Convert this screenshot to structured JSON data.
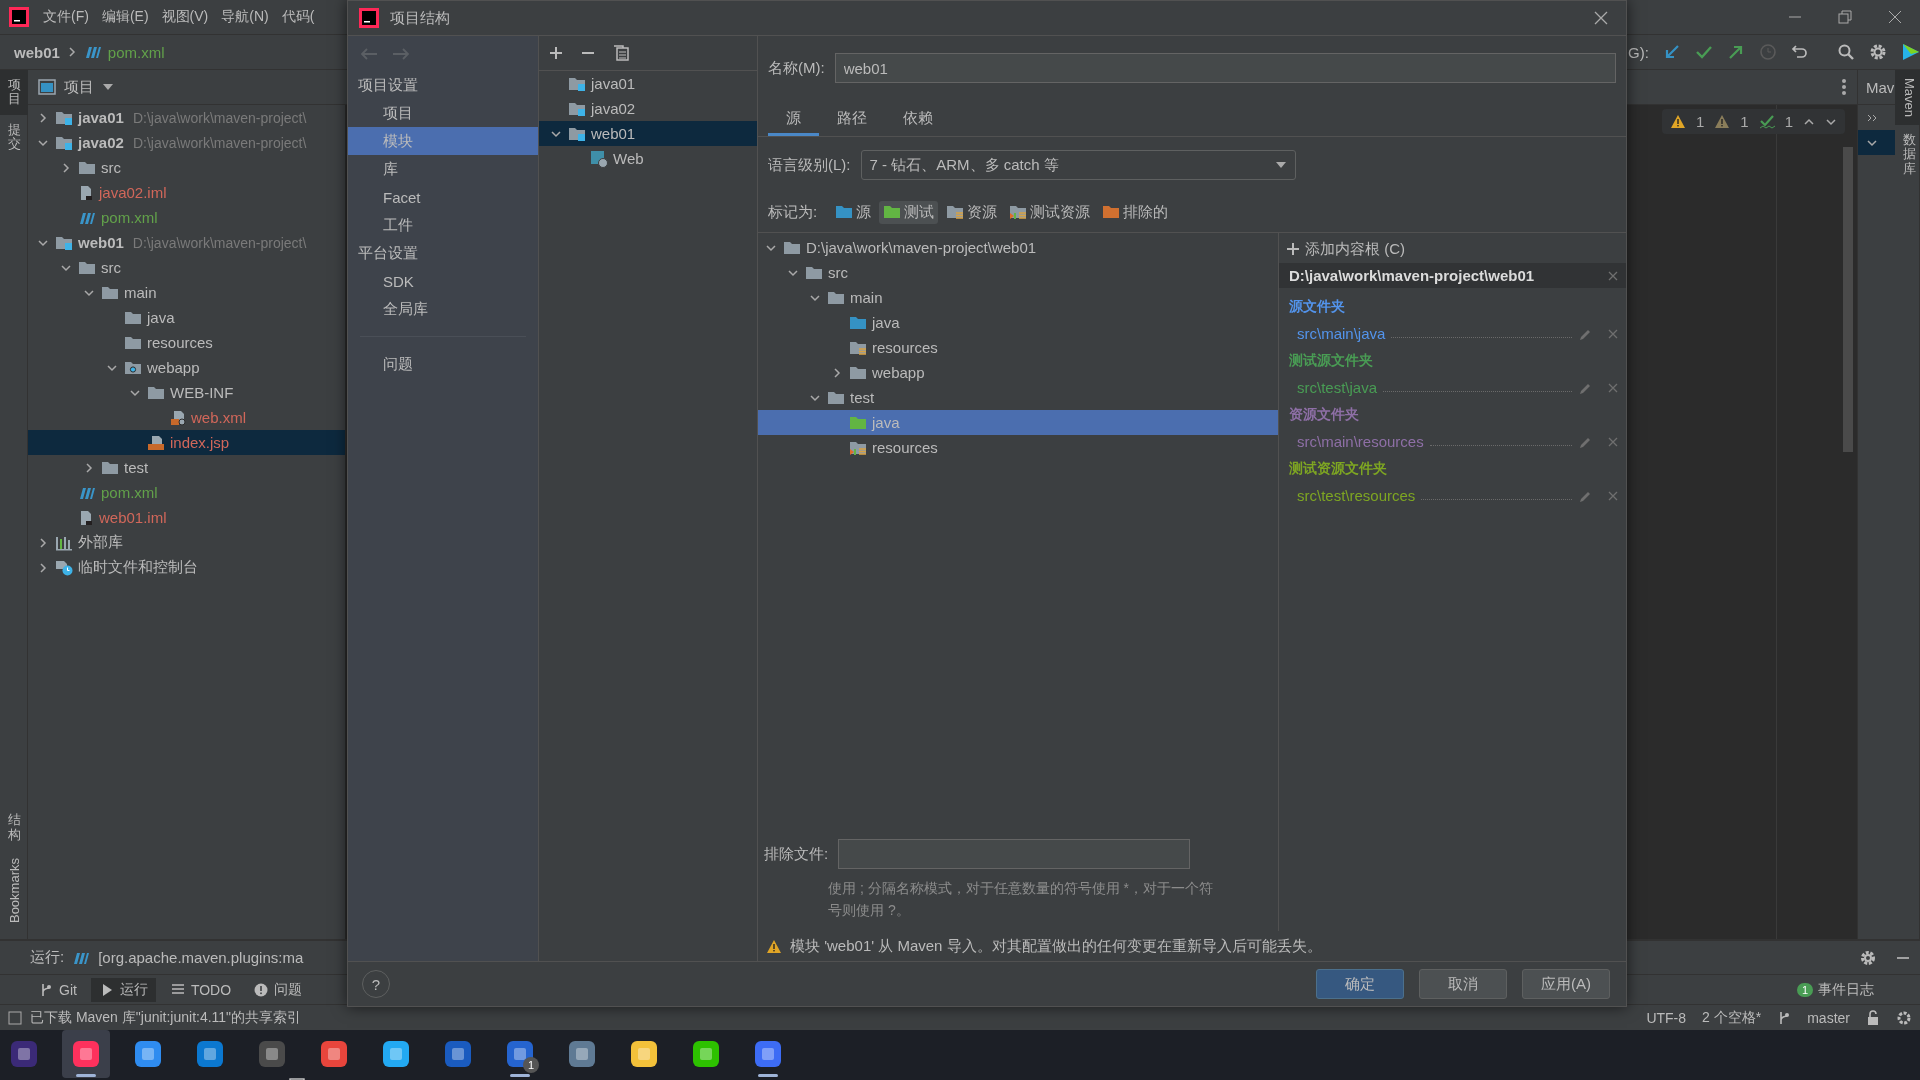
{
  "menu_bar": {
    "items": [
      "文件(F)",
      "编辑(E)",
      "视图(V)",
      "导航(N)",
      "代码("
    ]
  },
  "nav_bar": {
    "breadcrumbs": [
      {
        "label": "web01",
        "kind": "module"
      },
      {
        "label": "pom.xml",
        "kind": "maven"
      }
    ],
    "vcs_label": "G):"
  },
  "left_tool_strip": {
    "top": [
      {
        "label": "项目",
        "stacked": true,
        "selected": true
      },
      {
        "label": "提交",
        "stacked": true,
        "selected": false
      }
    ],
    "bottom": [
      {
        "label": "结构",
        "stacked": true,
        "selected": false
      },
      {
        "label": "Bookmarks",
        "stacked": false,
        "selected": false
      }
    ]
  },
  "project_panel": {
    "title": "项目",
    "tree": [
      {
        "name": "java01",
        "kind": "module",
        "path": "D:\\java\\work\\maven-project\\",
        "expanded": false,
        "selected": false
      },
      {
        "name": "java02",
        "kind": "module",
        "path": "D:\\java\\work\\maven-project\\",
        "expanded": true,
        "selected": false,
        "children": [
          {
            "name": "src",
            "kind": "folder",
            "expanded": false,
            "selected": false
          },
          {
            "name": "java02.iml",
            "kind": "iml",
            "color": "#d1675a",
            "selected": false
          },
          {
            "name": "pom.xml",
            "kind": "maven",
            "color": "#62a14a",
            "selected": false
          }
        ]
      },
      {
        "name": "web01",
        "kind": "module",
        "path": "D:\\java\\work\\maven-project\\",
        "expanded": true,
        "selected": false,
        "children": [
          {
            "name": "src",
            "kind": "folder",
            "expanded": true,
            "selected": false,
            "children": [
              {
                "name": "main",
                "kind": "folder",
                "expanded": true,
                "selected": false,
                "children": [
                  {
                    "name": "java",
                    "kind": "folder",
                    "selected": false
                  },
                  {
                    "name": "resources",
                    "kind": "folder",
                    "selected": false
                  },
                  {
                    "name": "webapp",
                    "kind": "web_folder",
                    "expanded": true,
                    "selected": false,
                    "children": [
                      {
                        "name": "WEB-INF",
                        "kind": "folder",
                        "expanded": true,
                        "selected": false,
                        "children": [
                          {
                            "name": "web.xml",
                            "kind": "web_xml",
                            "color": "#d1675a",
                            "selected": false
                          }
                        ]
                      },
                      {
                        "name": "index.jsp",
                        "kind": "jsp",
                        "color": "#d1675a",
                        "selected": true
                      }
                    ]
                  }
                ]
              },
              {
                "name": "test",
                "kind": "folder",
                "expanded": false,
                "selected": false
              }
            ]
          },
          {
            "name": "pom.xml",
            "kind": "maven",
            "color": "#62a14a",
            "selected": false
          },
          {
            "name": "web01.iml",
            "kind": "iml",
            "color": "#d1675a",
            "selected": false
          }
        ]
      },
      {
        "name": "外部库",
        "kind": "libraries",
        "expanded": false,
        "selected": false
      },
      {
        "name": "临时文件和控制台",
        "kind": "scratches",
        "expanded": false,
        "selected": false
      }
    ]
  },
  "editor": {
    "problems": [
      {
        "kind": "warning",
        "count": "1"
      },
      {
        "kind": "weak_warning",
        "count": "1"
      },
      {
        "kind": "typo",
        "count": "1"
      }
    ]
  },
  "maven_panel": {
    "title": "Mav"
  },
  "right_tool_strip": [
    {
      "label": "Maven",
      "stacked": false,
      "selected": true
    },
    {
      "label": "数据库",
      "stacked": true,
      "selected": false
    }
  ],
  "run_bar": {
    "label": "运行:",
    "config": "[org.apache.maven.plugins:ma"
  },
  "tool_tabs": [
    {
      "label": "Git",
      "kind": "git",
      "selected": false
    },
    {
      "label": "运行",
      "kind": "run",
      "selected": true
    },
    {
      "label": "TODO",
      "kind": "todo",
      "selected": false
    },
    {
      "label": "问题",
      "kind": "problems",
      "selected": false
    }
  ],
  "event_log": {
    "label": "事件日志",
    "badge": "1"
  },
  "status_bar": {
    "message": "已下载 Maven 库\"junit:junit:4.11\"的共享索引",
    "encoding": "UTF-8",
    "indent": "2 个空格*",
    "branch": "master"
  },
  "dialog": {
    "title": "项目结构",
    "nav": {
      "groups": [
        {
          "heading": "项目设置",
          "items": [
            {
              "label": "项目",
              "selected": false
            },
            {
              "label": "模块",
              "selected": true
            },
            {
              "label": "库",
              "selected": false
            },
            {
              "label": "Facet",
              "selected": false
            },
            {
              "label": "工件",
              "selected": false
            }
          ]
        },
        {
          "heading": "平台设置",
          "items": [
            {
              "label": "SDK",
              "selected": false
            },
            {
              "label": "全局库",
              "selected": false
            }
          ]
        }
      ],
      "problems": {
        "label": "问题",
        "selected": false
      }
    },
    "modules": [
      {
        "name": "java01",
        "kind": "module",
        "selected": false
      },
      {
        "name": "java02",
        "kind": "module",
        "selected": false
      },
      {
        "name": "web01",
        "kind": "module",
        "expanded": true,
        "selected": true,
        "children": [
          {
            "name": "Web",
            "kind": "web_facet",
            "selected": false
          }
        ]
      }
    ],
    "name_field": {
      "label": "名称(M):",
      "value": "web01"
    },
    "tabs": [
      {
        "label": "源",
        "selected": true
      },
      {
        "label": "路径",
        "selected": false
      },
      {
        "label": "依赖",
        "selected": false
      }
    ],
    "language_level": {
      "label": "语言级别(L):",
      "value": "7 - 钻石、ARM、多 catch 等"
    },
    "mark_as": {
      "label": "标记为:",
      "options": [
        {
          "label": "源",
          "kind": "sources",
          "selected": false
        },
        {
          "label": "测试",
          "kind": "tests",
          "selected": true
        },
        {
          "label": "资源",
          "kind": "resources",
          "selected": false
        },
        {
          "label": "测试资源",
          "kind": "test_resources",
          "selected": false
        },
        {
          "label": "排除的",
          "kind": "excluded",
          "selected": false
        }
      ]
    },
    "content_tree": [
      {
        "name": "D:\\java\\work\\maven-project\\web01",
        "kind": "folder",
        "expanded": true,
        "selected": false,
        "children": [
          {
            "name": "src",
            "kind": "folder",
            "expanded": true,
            "selected": false,
            "children": [
              {
                "name": "main",
                "kind": "folder",
                "expanded": true,
                "selected": false,
                "children": [
                  {
                    "name": "java",
                    "kind": "sources",
                    "selected": false
                  },
                  {
                    "name": "resources",
                    "kind": "resources",
                    "selected": false
                  },
                  {
                    "name": "webapp",
                    "kind": "folder",
                    "expanded": false,
                    "selected": false
                  }
                ]
              },
              {
                "name": "test",
                "kind": "folder",
                "expanded": true,
                "selected": false,
                "children": [
                  {
                    "name": "java",
                    "kind": "tests",
                    "selected": true
                  },
                  {
                    "name": "resources",
                    "kind": "test_resources",
                    "selected": false
                  }
                ]
              }
            ]
          }
        ]
      }
    ],
    "add_content_root": "添加内容根 (C)",
    "content_root": {
      "path": "D:\\java\\work\\maven-project\\web01",
      "folders": [
        {
          "heading": "源文件夹",
          "path": "src\\main\\java",
          "color": "#5394ec"
        },
        {
          "heading": "测试源文件夹",
          "path": "src\\test\\java",
          "color": "#499c54"
        },
        {
          "heading": "资源文件夹",
          "path": "src\\main\\resources",
          "color": "#8e6fa6"
        },
        {
          "heading": "测试资源文件夹",
          "path": "src\\test\\resources",
          "color": "#7ea622"
        }
      ]
    },
    "exclude_files": {
      "label": "排除文件:",
      "hint": "使用 ; 分隔名称模式，对于任意数量的符号使用 *，对于一个符号则使用 ?。"
    },
    "warning": "模块 'web01' 从 Maven 导入。对其配置做出的任何变更在重新导入后可能丢失。",
    "help_button": "?",
    "buttons": [
      {
        "label": "确定",
        "kind": "default"
      },
      {
        "label": "取消",
        "kind": "normal"
      },
      {
        "label": "应用(A)",
        "kind": "normal"
      }
    ]
  },
  "taskbar": {
    "apps": [
      {
        "color": "#3b2a77",
        "running": false,
        "active": false
      },
      {
        "color": "#fe315d",
        "running": true,
        "active": true
      },
      {
        "color": "#2f8cf0",
        "running": false,
        "active": false
      },
      {
        "color": "#0b78d0",
        "running": false,
        "active": false
      },
      {
        "color": "#4a4a4a",
        "running": false,
        "active": false
      },
      {
        "color": "#e8453c",
        "running": false,
        "active": false
      },
      {
        "color": "#23a9f2",
        "running": false,
        "active": false
      },
      {
        "color": "#1a5bbf",
        "running": false,
        "active": false
      },
      {
        "color": "#2564cf",
        "running": true,
        "active": false,
        "badge": "1"
      },
      {
        "color": "#5f7a94",
        "running": false,
        "active": false
      },
      {
        "color": "#f3c13a",
        "running": false,
        "active": false
      },
      {
        "color": "#2dc100",
        "running": false,
        "active": false
      },
      {
        "color": "#3d6cf5",
        "running": true,
        "active": false
      }
    ]
  }
}
